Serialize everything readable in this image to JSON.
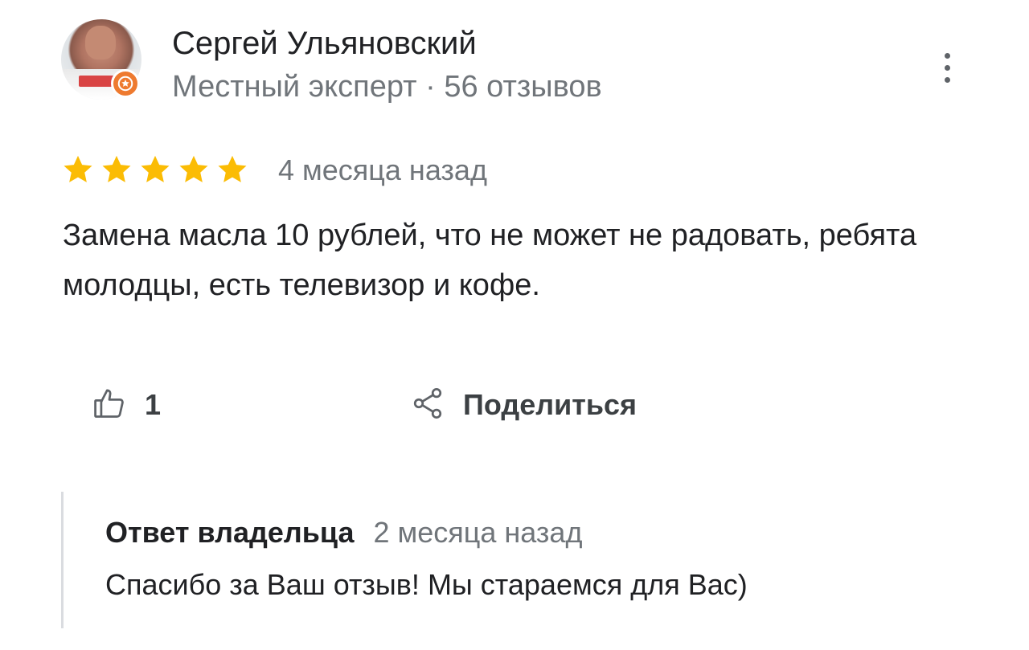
{
  "author": {
    "name": "Сергей Ульяновский",
    "meta": "Местный эксперт · 56 отзывов",
    "avatar_icon": "user-photo",
    "badge_icon": "local-guide-star-icon",
    "badge_color": "#ee7a2f"
  },
  "menu": {
    "icon": "more-vertical-icon"
  },
  "review": {
    "rating": 5,
    "rating_max": 5,
    "star_color": "#fbbc04",
    "date": "4 месяца назад",
    "text": "Замена масла 10 рублей, что не может не радовать, ребята молодцы, есть телевизор и кофе."
  },
  "actions": {
    "like_icon": "thumb-up-icon",
    "like_count": "1",
    "share_icon": "share-icon",
    "share_label": "Поделиться"
  },
  "owner_reply": {
    "title": "Ответ владельца",
    "date": "2 месяца назад",
    "text": "Спасибо за Ваш отзыв! Мы стараемся для Вас)"
  },
  "colors": {
    "primary_text": "#202124",
    "secondary_text": "#70757a",
    "divider": "#dadce0"
  }
}
